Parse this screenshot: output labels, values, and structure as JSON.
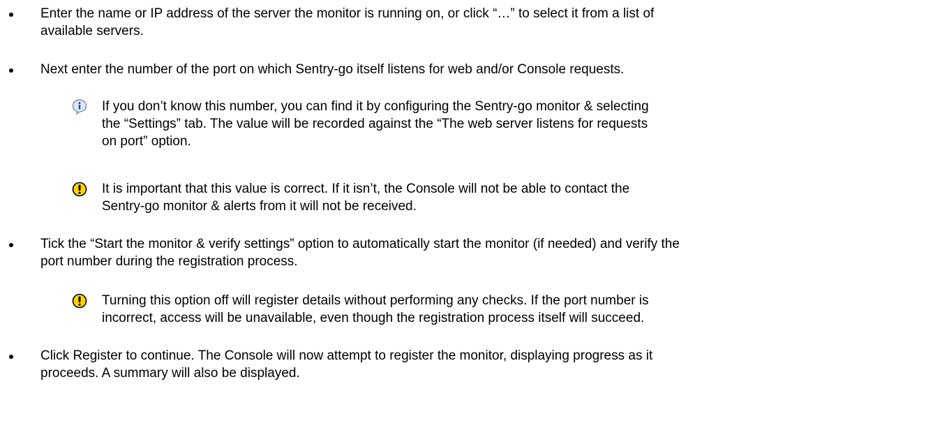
{
  "bullets": [
    {
      "text": "Enter the name or IP address of the server the monitor is running on, or click “…” to select it from a list of\navailable servers."
    },
    {
      "text": "Next enter the number of the port on which Sentry-go itself listens for web and/or Console requests.",
      "notes": [
        {
          "icon": "info-icon",
          "text": "If you don’t know this number, you can find it by configuring the Sentry-go monitor & selecting\nthe “Settings” tab. The value will be recorded against the “The web server listens for requests\non port” option."
        },
        {
          "icon": "warning-icon",
          "text": "It is important that this value is correct. If it isn’t, the Console will not be able to contact the\nSentry-go monitor & alerts from it will not be received."
        }
      ]
    },
    {
      "text": "Tick the “Start the monitor & verify settings” option to automatically start the monitor (if needed) and verify the\nport number during the registration process.",
      "notes": [
        {
          "icon": "warning-icon",
          "text": "Turning this option off will register details without performing any checks. If the port number is\nincorrect, access will be unavailable, even though the registration process itself will succeed."
        }
      ]
    },
    {
      "text": "Click Register to continue. The Console will now attempt to register the monitor, displaying progress as it\nproceeds. A summary will also be displayed."
    }
  ],
  "colors": {
    "text": "#000000",
    "info_icon_fill": "#dfe8f6",
    "info_icon_accent": "#1f3fbf",
    "warning_icon_fill": "#ffd400",
    "warning_icon_stroke": "#000000"
  }
}
